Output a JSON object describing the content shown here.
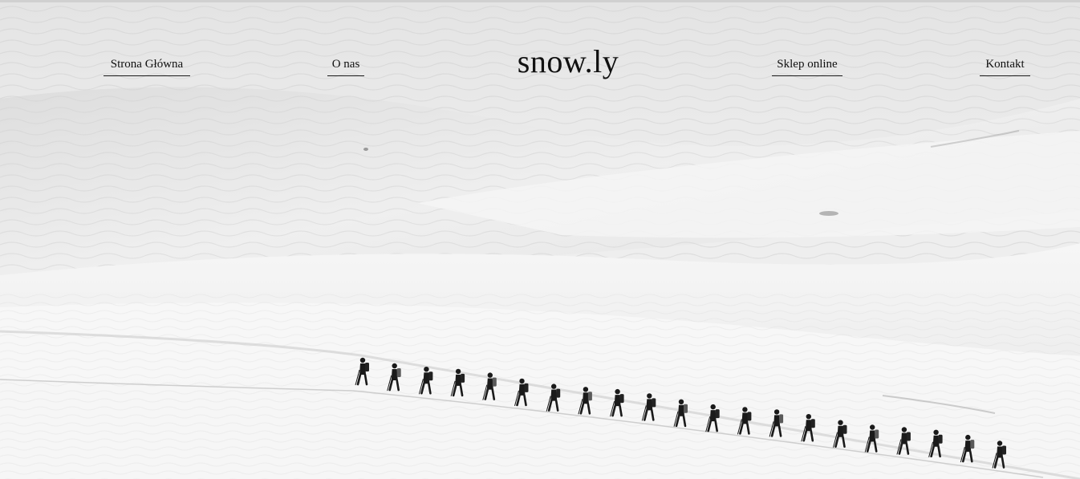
{
  "site": {
    "logo": "snow.ly"
  },
  "nav": {
    "items": [
      {
        "label": "Strona Główna"
      },
      {
        "label": "O nas"
      },
      {
        "label": "Sklep online"
      },
      {
        "label": "Kontakt"
      }
    ]
  },
  "hero": {
    "hikers_count": 21
  },
  "colors": {
    "text": "#111111",
    "snow_light": "#f3f3f3",
    "snow_shadow": "#c9c9c9",
    "hiker": "#1a1a1a"
  }
}
